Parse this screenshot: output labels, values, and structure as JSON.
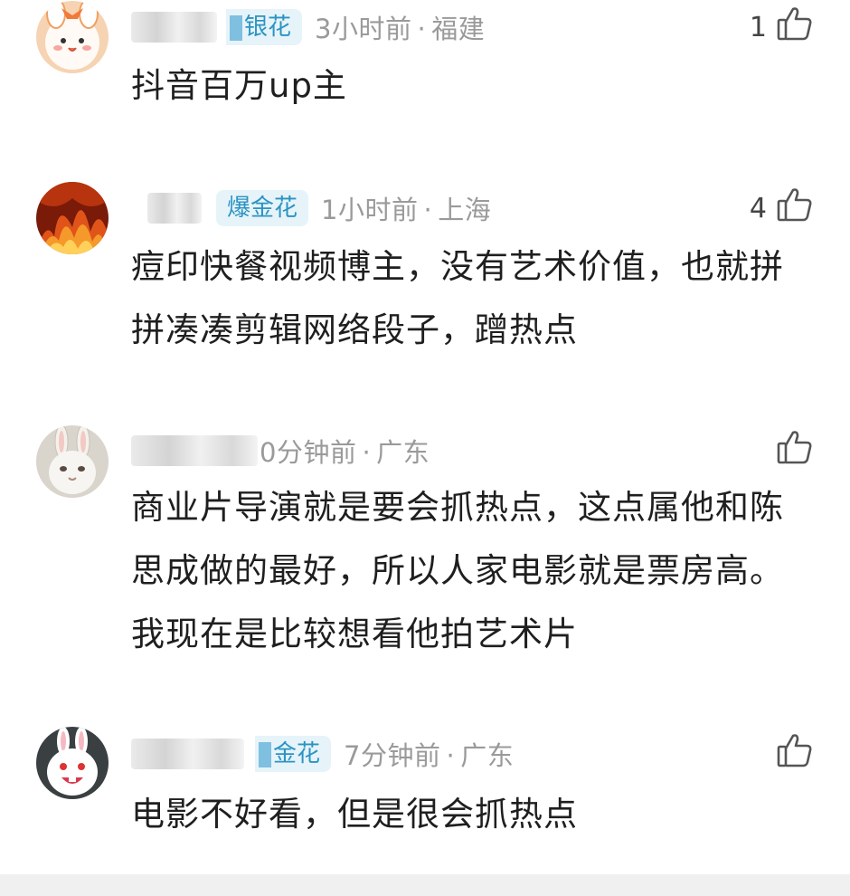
{
  "comments": [
    {
      "badge": "银花",
      "time": "3小时前",
      "location": "福建",
      "likes": "1",
      "text": "抖音百万up主",
      "avatar": "cute-bunny-avatar"
    },
    {
      "badge": "爆金花",
      "time": "1小时前",
      "location": "上海",
      "likes": "4",
      "text": "痘印快餐视频博主，没有艺术价值，也就拼拼凑凑剪辑网络段子，蹭热点",
      "avatar": "fire-avatar"
    },
    {
      "badge": "",
      "time": "0分钟前",
      "location": "广东",
      "likes": "",
      "text": "商业片导演就是要会抓热点，这点属他和陈思成做的最好，所以人家电影就是票房高。我现在是比较想看他拍艺术片",
      "avatar": "bunny-photo-avatar"
    },
    {
      "badge": "金花",
      "time": "7分钟前",
      "location": "广东",
      "likes": "",
      "text": "电影不好看，但是很会抓热点",
      "avatar": "snowball-rabbit-avatar"
    }
  ],
  "separator": "·",
  "icons": {
    "like": "thumbs-up-icon"
  },
  "colors": {
    "badge_text": "#2c93c4",
    "badge_bg": "#e6f4f9",
    "meta_text": "#9a9a9a"
  }
}
